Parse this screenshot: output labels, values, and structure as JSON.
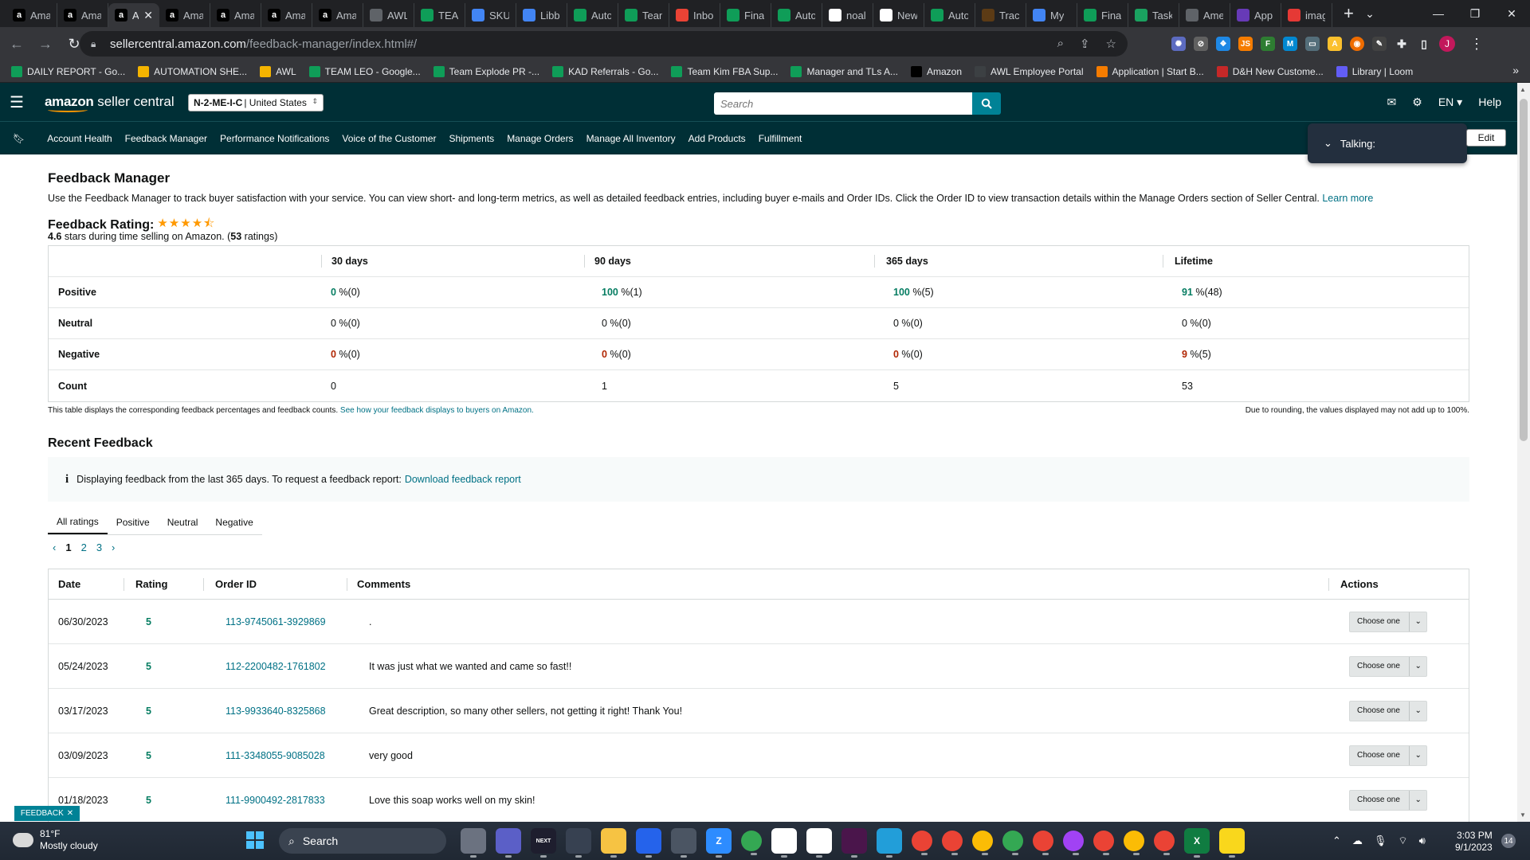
{
  "browser": {
    "tabs": [
      {
        "label": "Ama",
        "icon": "amazon-icon",
        "color": "#000000"
      },
      {
        "label": "Ama",
        "icon": "amazon-icon",
        "color": "#000000"
      },
      {
        "label": "A",
        "icon": "amazon-icon",
        "color": "#000000",
        "active": true
      },
      {
        "label": "Ama",
        "icon": "amazon-icon",
        "color": "#000000"
      },
      {
        "label": "Ama",
        "icon": "amazon-icon",
        "color": "#000000"
      },
      {
        "label": "Ama",
        "icon": "amazon-icon",
        "color": "#000000"
      },
      {
        "label": "Ama",
        "icon": "amazon-icon",
        "color": "#000000"
      },
      {
        "label": "AWL",
        "icon": "globe-icon",
        "color": "#5f6368"
      },
      {
        "label": "TEAI",
        "icon": "sheets-icon",
        "color": "#0f9d58"
      },
      {
        "label": "SKU",
        "icon": "drive-icon",
        "color": "#4285f4"
      },
      {
        "label": "Libb",
        "icon": "drive-icon",
        "color": "#4285f4"
      },
      {
        "label": "Auto",
        "icon": "sheets-icon",
        "color": "#0f9d58"
      },
      {
        "label": "Team",
        "icon": "sheets-icon",
        "color": "#0f9d58"
      },
      {
        "label": "Inbo",
        "icon": "gmail-icon",
        "color": "#ea4335"
      },
      {
        "label": "Fina",
        "icon": "sheets-icon",
        "color": "#0f9d58"
      },
      {
        "label": "Auto",
        "icon": "sheets-icon",
        "color": "#0f9d58"
      },
      {
        "label": "noal",
        "icon": "google-icon",
        "color": "#ffffff"
      },
      {
        "label": "New",
        "icon": "openai-icon",
        "color": "#ffffff"
      },
      {
        "label": "Auto",
        "icon": "sheets-icon",
        "color": "#0f9d58"
      },
      {
        "label": "Trac",
        "icon": "ups-icon",
        "color": "#5c3b15"
      },
      {
        "label": "My",
        "icon": "drive-icon",
        "color": "#4285f4"
      },
      {
        "label": "Fina",
        "icon": "sheets-icon",
        "color": "#0f9d58"
      },
      {
        "label": "Task",
        "icon": "task-icon",
        "color": "#1aa260"
      },
      {
        "label": "Ame",
        "icon": "globe-icon",
        "color": "#5f6368"
      },
      {
        "label": "App",
        "icon": "forms-icon",
        "color": "#673ab7"
      },
      {
        "label": "imag",
        "icon": "image-icon",
        "color": "#e53935"
      }
    ],
    "url_host": "sellercentral.amazon.com",
    "url_path": "/feedback-manager/index.html#/",
    "bookmarks": [
      {
        "label": "DAILY REPORT - Go...",
        "color": "#0f9d58"
      },
      {
        "label": "AUTOMATION SHE...",
        "color": "#f4b400"
      },
      {
        "label": "AWL",
        "color": "#f4b400"
      },
      {
        "label": "TEAM LEO - Google...",
        "color": "#0f9d58"
      },
      {
        "label": "Team Explode PR -...",
        "color": "#0f9d58"
      },
      {
        "label": "KAD Referrals - Go...",
        "color": "#0f9d58"
      },
      {
        "label": "Team Kim FBA Sup...",
        "color": "#0f9d58"
      },
      {
        "label": "Manager and TLs A...",
        "color": "#0f9d58"
      },
      {
        "label": "Amazon",
        "color": "#000000"
      },
      {
        "label": "AWL Employee Portal",
        "color": "#3c4043"
      },
      {
        "label": "Application | Start B...",
        "color": "#f57c00"
      },
      {
        "label": "D&H New Custome...",
        "color": "#c62828"
      },
      {
        "label": "Library | Loom",
        "color": "#625df5"
      }
    ],
    "profile_initial": "J"
  },
  "header": {
    "logo_bold": "amazon",
    "logo_rest": " seller central",
    "store_code": "N-2-ME-I-C",
    "store_region": "| United States",
    "search_placeholder": "Search",
    "language": "EN",
    "help": "Help",
    "nav": [
      "Account Health",
      "Feedback Manager",
      "Performance Notifications",
      "Voice of the Customer",
      "Shipments",
      "Manage Orders",
      "Manage All Inventory",
      "Add Products",
      "Fulfillment"
    ],
    "talking": "Talking:",
    "edit": "Edit"
  },
  "page": {
    "title": "Feedback Manager",
    "description": "Use the Feedback Manager to track buyer satisfaction with your service. You can view short- and long-term metrics, as well as detailed feedback entries, including buyer e-mails and Order IDs. Click the Order ID to view transaction details within the Manage Orders section of Seller Central.",
    "learn_more": "Learn more",
    "rating_label": "Feedback Rating:",
    "stars": 4.6,
    "rating_value": "4.6",
    "rating_mid": " stars during time selling on Amazon. (",
    "rating_count": "53",
    "rating_end": " ratings)"
  },
  "metrics": {
    "columns": [
      "30 days",
      "90 days",
      "365 days",
      "Lifetime"
    ],
    "rows": [
      {
        "label": "Positive",
        "cells": [
          {
            "v": "0",
            "p": " %(0)"
          },
          {
            "v": "100",
            "p": " %(1)"
          },
          {
            "v": "100",
            "p": " %(5)"
          },
          {
            "v": "91",
            "p": " %(48)"
          }
        ]
      },
      {
        "label": "Neutral",
        "cells": [
          {
            "v": "0",
            "p": " %(0)"
          },
          {
            "v": "0",
            "p": " %(0)"
          },
          {
            "v": "0",
            "p": " %(0)"
          },
          {
            "v": "0",
            "p": " %(0)"
          }
        ]
      },
      {
        "label": "Negative",
        "cells": [
          {
            "v": "0",
            "p": " %(0)"
          },
          {
            "v": "0",
            "p": " %(0)"
          },
          {
            "v": "0",
            "p": " %(0)"
          },
          {
            "v": "9",
            "p": " %(5)"
          }
        ]
      },
      {
        "label": "Count",
        "cells": [
          {
            "v": "0",
            "p": ""
          },
          {
            "v": "1",
            "p": ""
          },
          {
            "v": "5",
            "p": ""
          },
          {
            "v": "53",
            "p": ""
          }
        ]
      }
    ],
    "note": "This table displays the corresponding feedback percentages and feedback counts.",
    "note_link": "See how your feedback displays to buyers on Amazon.",
    "rounding_note": "Due to rounding, the values displayed may not add up to 100%."
  },
  "recent": {
    "title": "Recent Feedback",
    "info_text": "Displaying feedback from the last 365 days. To request a feedback report:",
    "info_link": "Download feedback report",
    "tabs": [
      "All ratings",
      "Positive",
      "Neutral",
      "Negative"
    ],
    "pages": [
      "1",
      "2",
      "3"
    ],
    "columns": [
      "Date",
      "Rating",
      "Order ID",
      "Comments",
      "Actions"
    ],
    "rows": [
      {
        "date": "06/30/2023",
        "rating": "5",
        "order": "113-9745061-3929869",
        "comment": ".",
        "action": "Choose one"
      },
      {
        "date": "05/24/2023",
        "rating": "5",
        "order": "112-2200482-1761802",
        "comment": "It was just what we wanted and came so fast!!",
        "action": "Choose one"
      },
      {
        "date": "03/17/2023",
        "rating": "5",
        "order": "113-9933640-8325868",
        "comment": "Great description, so many other sellers, not getting it right! Thank You!",
        "action": "Choose one"
      },
      {
        "date": "03/09/2023",
        "rating": "5",
        "order": "111-3348055-9085028",
        "comment": "very good",
        "action": "Choose one"
      },
      {
        "date": "01/18/2023",
        "rating": "5",
        "order": "111-9900492-2817833",
        "comment": "Love this soap works well on my skin!",
        "action": "Choose one"
      }
    ],
    "feedback_pill": "FEEDBACK"
  },
  "taskbar": {
    "temp": "81°F",
    "weather": "Mostly cloudy",
    "search": "Search",
    "time": "3:03 PM",
    "date": "9/1/2023",
    "notifications": "14",
    "apps": [
      {
        "icon": "file-explorer-icon",
        "color": "#6b7280"
      },
      {
        "icon": "meet-icon",
        "color": "#5b5fc7"
      },
      {
        "icon": "next-icon",
        "color": "#1e1e2e"
      },
      {
        "icon": "refresh-app-icon",
        "color": "#374151"
      },
      {
        "icon": "folder-icon",
        "color": "#f6c343"
      },
      {
        "icon": "calendar-icon",
        "color": "#2563eb"
      },
      {
        "icon": "calculator-icon",
        "color": "#4b5563"
      },
      {
        "icon": "zoom-icon",
        "color": "#2d8cff"
      },
      {
        "icon": "chrome-icon",
        "color": "#34a853"
      },
      {
        "icon": "canva-icon",
        "color": "#ffffff"
      },
      {
        "icon": "chart-app-icon",
        "color": "#ffffff"
      },
      {
        "icon": "slack-icon",
        "color": "#4a154b"
      },
      {
        "icon": "telegram-icon",
        "color": "#229ed9"
      },
      {
        "icon": "chrome-icon",
        "color": "#ea4335"
      },
      {
        "icon": "chrome-icon",
        "color": "#ea4335"
      },
      {
        "icon": "chrome-icon",
        "color": "#fbbc05"
      },
      {
        "icon": "chrome-icon",
        "color": "#34a853"
      },
      {
        "icon": "chrome-icon",
        "color": "#ea4335"
      },
      {
        "icon": "chrome-icon",
        "color": "#a142f4"
      },
      {
        "icon": "chrome-icon",
        "color": "#ea4335"
      },
      {
        "icon": "chrome-icon",
        "color": "#fbbc05"
      },
      {
        "icon": "chrome-icon",
        "color": "#ea4335"
      },
      {
        "icon": "excel-icon",
        "color": "#107c41"
      },
      {
        "icon": "sticky-notes-icon",
        "color": "#f9d71c"
      }
    ]
  }
}
